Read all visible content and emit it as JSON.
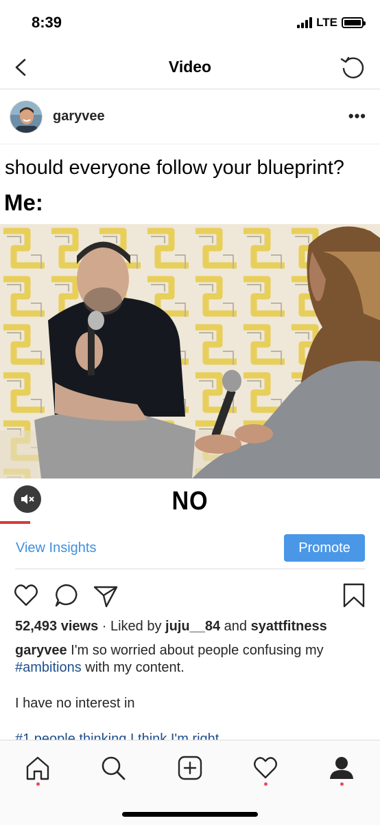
{
  "status": {
    "time": "8:39",
    "network": "LTE"
  },
  "nav": {
    "title": "Video",
    "back_icon": "chevron-left-icon",
    "refresh_icon": "refresh-icon"
  },
  "post": {
    "username": "garyvee",
    "more_label": "•••"
  },
  "video": {
    "meme_top": "should everyone follow your blueprint?",
    "meme_me": "Me:",
    "meme_answer": "NO",
    "progress": 0.08,
    "mute_icon": "speaker-muted-icon"
  },
  "insights": {
    "link": "View Insights",
    "promote": "Promote"
  },
  "engagement": {
    "views": "52,493 views",
    "liked_prefix": " · Liked by ",
    "liked_user": "juju__84",
    "and": " and ",
    "liked_user2": "syattfitness"
  },
  "caption": {
    "user": "garyvee",
    "text1": " I'm so worried about people confusing my ",
    "hashtag": "#ambitions",
    "text2": " with my content.",
    "line2": "I have no interest in",
    "line3": "#1 people thinking I think I'm right"
  },
  "colors": {
    "accent": "#3e8fde",
    "promote_bg": "#4a97e8",
    "notification_dot": "#ed4956",
    "progress": "#d83a3a"
  }
}
